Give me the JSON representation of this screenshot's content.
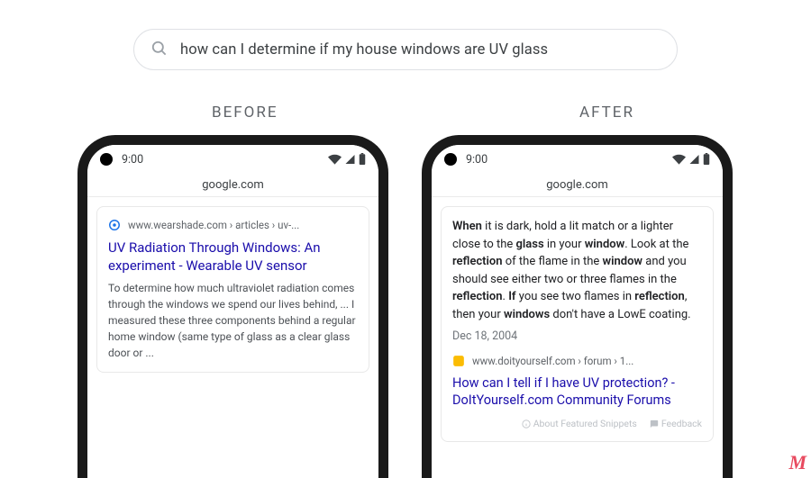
{
  "search": {
    "query": "how can I determine if my house windows are UV glass"
  },
  "labels": {
    "before": "BEFORE",
    "after": "AFTER"
  },
  "phone": {
    "time": "9:00",
    "address": "google.com"
  },
  "before_result": {
    "breadcrumb": "www.wearshade.com › articles › uv-...",
    "title": "UV Radiation Through Windows: An experiment - Wearable UV sensor",
    "snippet": "To determine how much ultraviolet radiation comes through the windows we spend our lives behind, ... I measured these three components behind a regular home window (same type of glass as a clear glass door or  ..."
  },
  "after_result": {
    "snippet_html": "<b>When</b> it is dark, hold a lit match or a lighter close to the <b>glass</b> in your <b>window</b>. Look at the <b>reflection</b> of the flame in the <b>window</b> and you should see either two or three flames in the <b>reflection</b>. <b>If</b> you see two flames in <b>reflection</b>, then your <b>windows</b> don't have a LowE coating.",
    "date": "Dec 18, 2004",
    "breadcrumb": "www.doityourself.com › forum › 1...",
    "title": "How can I tell if I have UV protection? - DoItYourself.com Community Forums",
    "footer_about": "About Featured Snippets",
    "footer_feedback": "Feedback"
  },
  "watermark": "M"
}
